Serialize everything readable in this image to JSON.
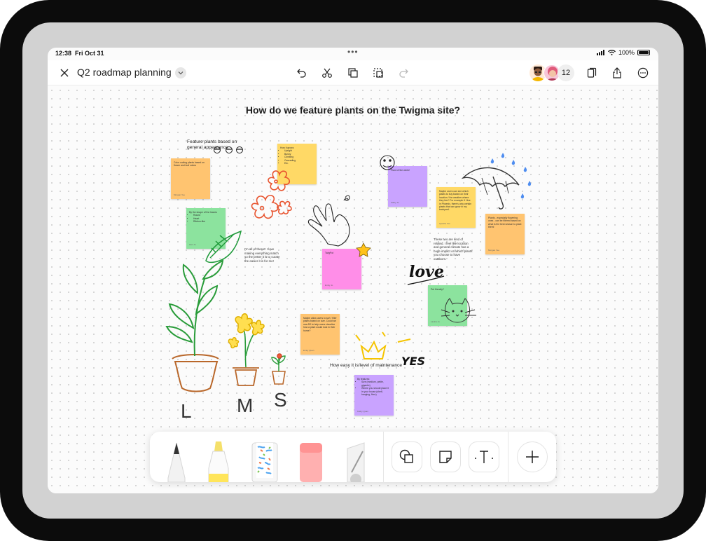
{
  "status": {
    "time": "12:38",
    "date": "Fri Oct 31",
    "battery": "100%"
  },
  "toolbar": {
    "file_title": "Q2 roadmap planning",
    "user_count": "12"
  },
  "board": {
    "title": "How do we feature plants on the Twigma site?",
    "label_appearance": "Feature plants based on general appearance",
    "label_maintenance": "How easy it is/level of maintenance",
    "note_mood": "I'm all of these!! I love making everything match so the better it is to curate the easier it is for me!",
    "note_climate": "These two are kind of related. I feel like location and general climate has a huge impact on which plants you choose to have outdoors.",
    "stickies": {
      "s1": {
        "text": "Color coding plants based on flower and leaf colors",
        "author": "Morgan Yee"
      },
      "s2": {
        "title": "How it grows",
        "items": [
          "Upright",
          "Bushy",
          "Climbing",
          "Cascading",
          "Etc."
        ]
      },
      "s3": {
        "title": "By the shape of the leaves",
        "items": [
          "Round",
          "Heart",
          "Ribbon-like"
        ],
        "author": "Han Jo"
      },
      "s4": {
        "text": "TwigPot",
        "author": "Emily Jo"
      },
      "s5": {
        "text": "Plant of the week!",
        "author": "Kathy Jo"
      },
      "s6": {
        "text": "Maybe users can see which plants to buy based on their location / the weather where they live? For example if I live in Phoenix, there's only certain plants that can grow in my backyard.",
        "author": "Ayesha Yee"
      },
      "s7": {
        "text": "Plants - especially flowering ones - can be filtered based on what is the best season to plant them!",
        "author": "Morgan Yee"
      },
      "s8": {
        "text": "Pet friendly?",
        "author": "Lavina Jo"
      },
      "s9": {
        "text": "Maybe allow users to sort / filter plants based on size. Could we use AR to help users visualize how a plant would look in their home?",
        "author": "Emily Quan"
      },
      "s10": {
        "title": "By features:",
        "items": [
          "Size (medium, petite, gigantic)",
          "Where you should place it in your house (shelf, hanging, floor)"
        ],
        "author": "Kathy Quan"
      }
    },
    "doodle_labels": {
      "l": "L",
      "m": "M",
      "s": "S",
      "love": "love",
      "yes": "YES"
    }
  },
  "icons": {
    "close": "close-icon",
    "chevron": "chevron-down-icon",
    "undo": "undo-icon",
    "scissors": "scissors-icon",
    "duplicate": "duplicate-icon",
    "select": "select-icon",
    "redo": "redo-icon",
    "pages": "pages-icon",
    "share": "share-icon",
    "more": "more-icon"
  },
  "colors": {
    "orange": "#ffc470",
    "yellow": "#ffd966",
    "green": "#8ce39e",
    "purple": "#c9a3ff",
    "pink": "#ff8ee8"
  }
}
